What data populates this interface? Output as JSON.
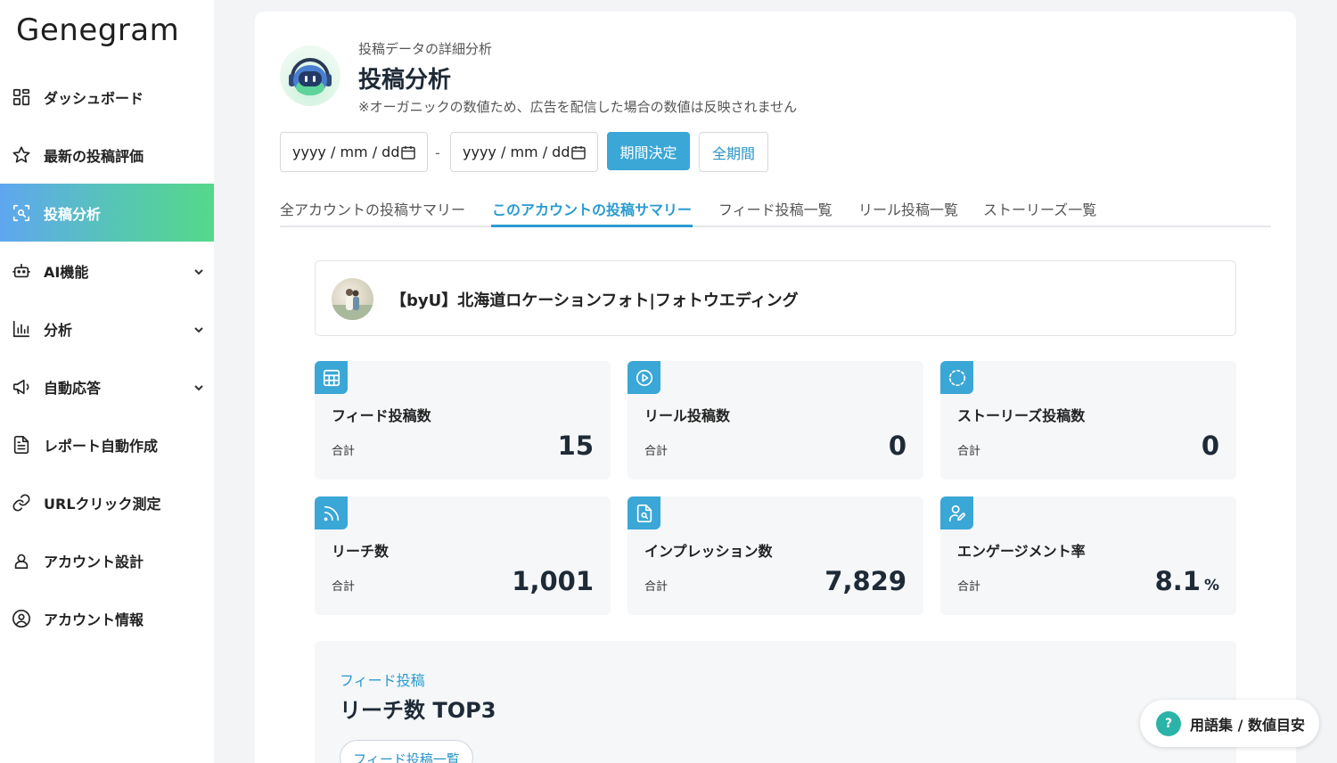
{
  "app": {
    "logo": "Genegram"
  },
  "sidebar": {
    "items": [
      {
        "label": "ダッシュボード",
        "icon": "grid-icon"
      },
      {
        "label": "最新の投稿評価",
        "icon": "star-icon"
      },
      {
        "label": "投稿分析",
        "icon": "scan-search-icon",
        "active": true
      },
      {
        "label": "AI機能",
        "icon": "robot-icon",
        "expandable": true
      },
      {
        "label": "分析",
        "icon": "bar-chart-icon",
        "expandable": true
      },
      {
        "label": "自動応答",
        "icon": "megaphone-icon",
        "expandable": true
      },
      {
        "label": "レポート自動作成",
        "icon": "document-icon"
      },
      {
        "label": "URLクリック測定",
        "icon": "link-icon"
      },
      {
        "label": "アカウント設計",
        "icon": "user-pin-icon"
      },
      {
        "label": "アカウント情報",
        "icon": "user-circle-icon"
      }
    ]
  },
  "header": {
    "subtitle": "投稿データの詳細分析",
    "title": "投稿分析",
    "note": "※オーガニックの数値ため、広告を配信した場合の数値は反映されません"
  },
  "filters": {
    "start_date_placeholder": "yyyy / mm / dd",
    "end_date_placeholder": "yyyy / mm / dd",
    "separator": "-",
    "apply_label": "期間決定",
    "all_label": "全期間"
  },
  "tabs": [
    {
      "label": "全アカウントの投稿サマリー"
    },
    {
      "label": "このアカウントの投稿サマリー",
      "active": true
    },
    {
      "label": "フィード投稿一覧"
    },
    {
      "label": "リール投稿一覧"
    },
    {
      "label": "ストーリーズ一覧"
    }
  ],
  "account": {
    "name": "【byU】北海道ロケーションフォト|フォトウエディング"
  },
  "stats": [
    {
      "title": "フィード投稿数",
      "label": "合計",
      "value": "15",
      "unit": "",
      "icon": "table-icon"
    },
    {
      "title": "リール投稿数",
      "label": "合計",
      "value": "0",
      "unit": "",
      "icon": "play-circle-icon"
    },
    {
      "title": "ストーリーズ投稿数",
      "label": "合計",
      "value": "0",
      "unit": "",
      "icon": "dashed-circle-icon"
    },
    {
      "title": "リーチ数",
      "label": "合計",
      "value": "1,001",
      "unit": "",
      "icon": "rss-icon"
    },
    {
      "title": "インプレッション数",
      "label": "合計",
      "value": "7,829",
      "unit": "",
      "icon": "file-search-icon"
    },
    {
      "title": "エンゲージメント率",
      "label": "合計",
      "value": "8.1",
      "unit": "%",
      "icon": "user-pen-icon"
    }
  ],
  "top3": {
    "kicker": "フィード投稿",
    "title": "リーチ数 TOP3",
    "button_label": "フィード投稿一覧"
  },
  "help": {
    "q": "?",
    "label": "用語集 / 数値目安"
  },
  "colors": {
    "accent": "#3aa7d6",
    "active_gradient_start": "#5fa6f0",
    "active_gradient_end": "#55d88a",
    "help_badge": "#2bb3a8"
  }
}
